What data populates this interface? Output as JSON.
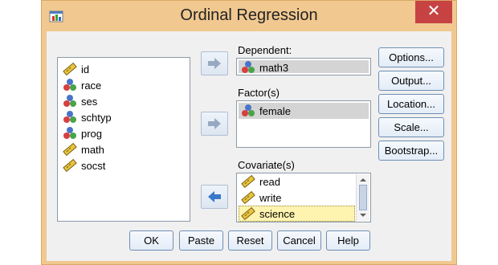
{
  "window": {
    "title": "Ordinal Regression",
    "close_glyph": "✕"
  },
  "source_list": [
    {
      "name": "id",
      "icon": "scale-ruler-icon"
    },
    {
      "name": "race",
      "icon": "nominal-balls-icon"
    },
    {
      "name": "ses",
      "icon": "nominal-balls-icon"
    },
    {
      "name": "schtyp",
      "icon": "nominal-balls-icon"
    },
    {
      "name": "prog",
      "icon": "nominal-balls-icon"
    },
    {
      "name": "math",
      "icon": "scale-ruler-icon"
    },
    {
      "name": "socst",
      "icon": "scale-ruler-icon"
    }
  ],
  "dependent": {
    "label": "Dependent:",
    "value": "math3",
    "icon": "nominal-balls-icon"
  },
  "factors": {
    "label": "Factor(s)",
    "items": [
      {
        "name": "female",
        "icon": "nominal-balls-icon"
      }
    ]
  },
  "covariates": {
    "label": "Covariate(s)",
    "items": [
      {
        "name": "read",
        "icon": "scale-ruler-icon"
      },
      {
        "name": "write",
        "icon": "scale-ruler-icon"
      },
      {
        "name": "science",
        "icon": "scale-ruler-icon"
      }
    ]
  },
  "side_buttons": [
    "Options...",
    "Output...",
    "Location...",
    "Scale...",
    "Bootstrap..."
  ],
  "bottom_buttons": [
    "OK",
    "Paste",
    "Reset",
    "Cancel",
    "Help"
  ],
  "colors": {
    "accent_arrow": "#3a78c9",
    "selection": "#fff3b0",
    "close": "#c74343",
    "frame": "#f0c890"
  }
}
